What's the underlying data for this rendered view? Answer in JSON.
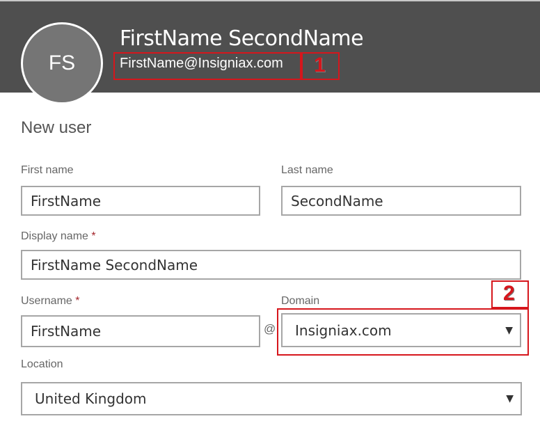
{
  "header": {
    "avatar_initials": "FS",
    "user_name": "FirstName SecondName",
    "user_email": "FirstName@Insigniax.com"
  },
  "annotations": {
    "first": "1",
    "second": "2",
    "color": "#d6161c"
  },
  "form": {
    "title": "New user",
    "first_name": {
      "label": "First name",
      "value": "FirstName"
    },
    "last_name": {
      "label": "Last name",
      "value": "SecondName"
    },
    "display_name": {
      "label": "Display name",
      "required_marker": "*",
      "value": "FirstName SecondName"
    },
    "username": {
      "label": "Username",
      "required_marker": "*",
      "value": "FirstName"
    },
    "at_sign": "@",
    "domain": {
      "label": "Domain",
      "value": "Insigniax.com",
      "arrow": "▼"
    },
    "location": {
      "label": "Location",
      "value": "United Kingdom",
      "arrow": "▼"
    }
  },
  "colors": {
    "header_bg": "#4f4f4f",
    "avatar_bg": "#757575",
    "required": "#a4262c"
  }
}
